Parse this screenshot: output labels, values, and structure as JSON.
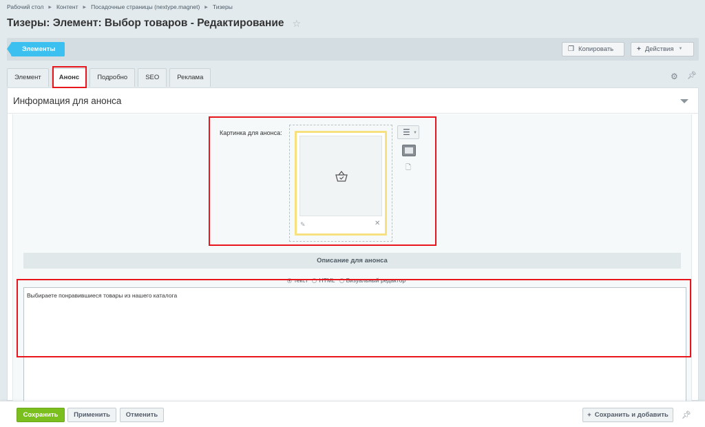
{
  "breadcrumb": [
    "Рабочий стол",
    "Контент",
    "Посадочные страницы (nextype.magnet)",
    "Тизеры"
  ],
  "page_title": "Тизеры: Элемент: Выбор товаров - Редактирование",
  "toolbar": {
    "elements_label": "Элементы",
    "copy_label": "Копировать",
    "actions_label": "Действия"
  },
  "tabs": [
    {
      "label": "Элемент",
      "active": false
    },
    {
      "label": "Анонс",
      "active": true
    },
    {
      "label": "Подробно",
      "active": false
    },
    {
      "label": "SEO",
      "active": false
    },
    {
      "label": "Реклама",
      "active": false
    }
  ],
  "section": {
    "title": "Информация для анонса",
    "image_label": "Картинка для анонса:",
    "description_header": "Описание для анонса",
    "radio_options": [
      {
        "label": "текст",
        "checked": true
      },
      {
        "label": "HTML",
        "checked": false
      },
      {
        "label": "Визуальный редактор",
        "checked": false
      }
    ],
    "description_text": "Выбираете понравившиеся товары из нашего каталога"
  },
  "footer": {
    "save_label": "Сохранить",
    "apply_label": "Применить",
    "cancel_label": "Отменить",
    "save_add_label": "Сохранить и добавить"
  },
  "colors": {
    "accent_blue": "#3bc0f0",
    "save_green": "#7bbf1f",
    "highlight_red": "#e8141c",
    "image_frame_yellow": "#f7e07e"
  }
}
